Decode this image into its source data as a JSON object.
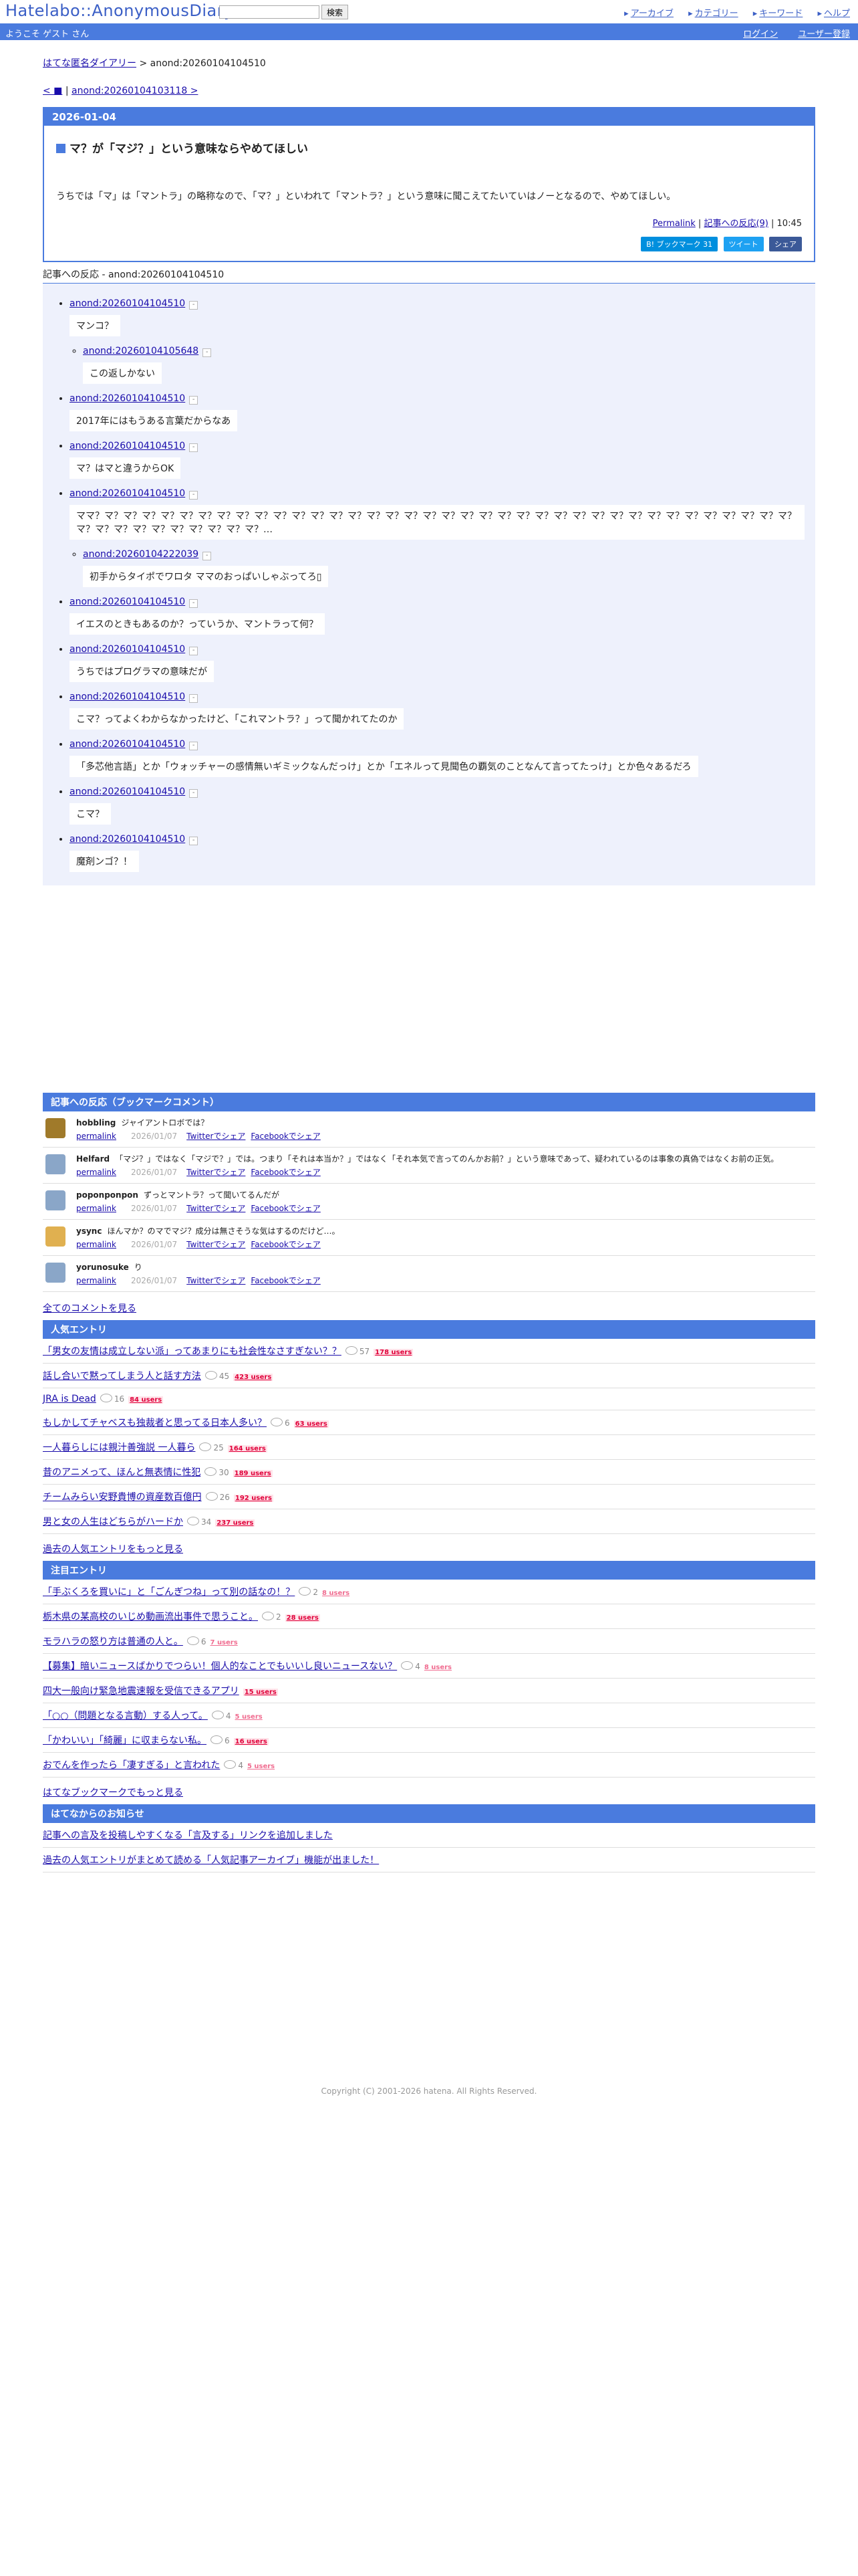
{
  "header": {
    "logo": "Hatelabo::AnonymousDiary",
    "search_placeholder": "",
    "search_button": "検索",
    "links": [
      "アーカイブ",
      "カテゴリー",
      "キーワード",
      "ヘルプ"
    ],
    "welcome": "ようこそ ゲスト さん",
    "login": "ログイン",
    "register": "ユーザー登録"
  },
  "breadcrumb": {
    "home": "はてな匿名ダイアリー",
    "sep": ">",
    "current": "anond:20260104104510"
  },
  "pager": {
    "prev": "< ■",
    "sep": "|",
    "next": "anond:20260104103118 >"
  },
  "entry": {
    "date": "2026-01-04",
    "title": "マ？が「マジ？」という意味ならやめてほしい",
    "body": "うちでは「マ」は「マントラ」の略称なので、「マ？」といわれて「マントラ？」という意味に聞こえてたいていはノーとなるので、やめてほしい。",
    "permalink": "Permalink",
    "reactions": "記事への反応(9)",
    "time": "10:45",
    "bookmark_btn": "B! ブックマーク 31",
    "tweet_btn": "ツイート",
    "share_btn": "シェア"
  },
  "responses": {
    "heading": "記事への反応 - anond:20260104104510",
    "items": [
      {
        "id": "anond:20260104104510",
        "text": "マンコ？",
        "child_id": "anond:20260104105648",
        "child_text": "この返しかない"
      },
      {
        "id": "anond:20260104104510",
        "text": "2017年にはもうある言葉だからなあ"
      },
      {
        "id": "anond:20260104104510",
        "text": "マ？はマと違うからOK"
      },
      {
        "id": "anond:20260104104510",
        "text": "ママ？マ？マ？マ？マ？マ？マ？マ？マ？マ？マ？マ？マ？マ？マ？マ？マ？マ？マ？マ？マ？マ？マ？マ？マ？マ？マ？マ？マ？マ？マ？マ？マ？マ？マ？マ？マ？マ？マ？マ？マ？マ？マ？マ？マ？マ？マ？マ？…",
        "child_id": "anond:20260104222039",
        "child_text": "初手からタイポでワロタ ママのおっぱいしゃぶってろ▯"
      },
      {
        "id": "anond:20260104104510",
        "text": "イエスのときもあるのか？っていうか、マントラって何？"
      },
      {
        "id": "anond:20260104104510",
        "text": "うちではプログラマの意味だが"
      },
      {
        "id": "anond:20260104104510",
        "text": "こマ？ってよくわからなかったけど、「これマントラ？」って聞かれてたのか"
      },
      {
        "id": "anond:20260104104510",
        "text": "「多芯他言語」とか「ウォッチャーの感情無いギミックなんだっけ」とか「エネルって見聞色の覇気のことなんて言ってたっけ」とか色々あるだろ"
      },
      {
        "id": "anond:20260104104510",
        "text": "こマ？"
      },
      {
        "id": "anond:20260104104510",
        "text": "魔剤ンゴ？！"
      }
    ]
  },
  "bookmark_comments": {
    "heading": "記事への反応（ブックマークコメント）",
    "items": [
      {
        "user": "hobbling",
        "text": "ジャイアントロボでは？",
        "date": "2026/01/07",
        "avatar_color": "#a07a2a"
      },
      {
        "user": "Helfard",
        "text": "「マジ？」ではなく「マジで？」では。つまり「それは本当か？」ではなく「それ本気で言ってのんかお前？」という意味であって、疑われているのは事象の真偽ではなくお前の正気。",
        "date": "2026/01/07",
        "avatar_color": "#8aa6c8"
      },
      {
        "user": "poponponpon",
        "text": "ずっとマントラ？って聞いてるんだが",
        "date": "2026/01/07",
        "avatar_color": "#8aa6c8"
      },
      {
        "user": "ysync",
        "text": "ほんマか？のマでマジ？成分は無さそうな気はするのだけど…。",
        "date": "2026/01/07",
        "avatar_color": "#e0b050"
      },
      {
        "user": "yorunosuke",
        "text": "り",
        "date": "2026/01/07",
        "avatar_color": "#8aa6c8"
      }
    ],
    "permalink": "permalink",
    "twitter": "Twitterでシェア",
    "facebook": "Facebookでシェア",
    "all_link": "全てのコメントを見る"
  },
  "popular": {
    "heading": "人気エントリ",
    "items": [
      {
        "title": "「男女の友情は成立しない派」ってあまりにも社会性なさすぎない？？",
        "count": "57",
        "users": "178 users",
        "hot": true
      },
      {
        "title": "話し合いで黙ってしまう人と話す方法",
        "count": "45",
        "users": "423 users",
        "hot": true
      },
      {
        "title": "JRA is Dead",
        "count": "16",
        "users": "84 users",
        "hot": true
      },
      {
        "title": "もしかしてチャベスも独裁者と思ってる日本人多い？",
        "count": "6",
        "users": "63 users",
        "hot": true
      },
      {
        "title": "一人暮らしには親汁善強説 一人暮ら",
        "count": "25",
        "users": "164 users",
        "hot": true
      },
      {
        "title": "昔のアニメって、ほんと無表情に性犯",
        "count": "30",
        "users": "189 users",
        "hot": true
      },
      {
        "title": "チームみらい安野貴博の資産数百億円",
        "count": "26",
        "users": "192 users",
        "hot": true
      },
      {
        "title": "男と女の人生はどちらがハードか",
        "count": "34",
        "users": "237 users",
        "hot": true
      }
    ],
    "more": "過去の人気エントリをもっと見る"
  },
  "featured": {
    "heading": "注目エントリ",
    "items": [
      {
        "title": "「手ぶくろを買いに」と「ごんぎつね」って別の話なの！？",
        "count": "2",
        "users": "8 users",
        "hot": false
      },
      {
        "title": "栃木県の某高校のいじめ動画流出事件で思うこと。",
        "count": "2",
        "users": "28 users",
        "hot": true
      },
      {
        "title": "モラハラの怒り方は普通の人と。",
        "count": "6",
        "users": "7 users",
        "hot": false
      },
      {
        "title": "【募集】暗いニュースばかりでつらい！個人的なことでもいいし良いニュースない？",
        "count": "4",
        "users": "8 users",
        "hot": false
      },
      {
        "title": "四大一般向け緊急地震速報を受信できるアプリ",
        "count": "",
        "users": "15 users",
        "hot": true
      },
      {
        "title": "「○○（問題となる言動）する人って。",
        "count": "4",
        "users": "5 users",
        "hot": false
      },
      {
        "title": "「かわいい」「綺麗」に収まらない私。",
        "count": "6",
        "users": "16 users",
        "hot": true
      },
      {
        "title": "おでんを作ったら「凄すぎる」と言われた",
        "count": "4",
        "users": "5 users",
        "hot": false
      }
    ],
    "more": "はてなブックマークでもっと見る"
  },
  "news": {
    "heading": "はてなからのお知らせ",
    "items": [
      "記事への言及を投稿しやすくなる「言及する」リンクを追加しました",
      "過去の人気エントリがまとめて読める「人気記事アーカイブ」機能が出ました！"
    ]
  },
  "footer": {
    "copyright": "Copyright (C) 2001-2026 hatena. All Rights Reserved."
  }
}
